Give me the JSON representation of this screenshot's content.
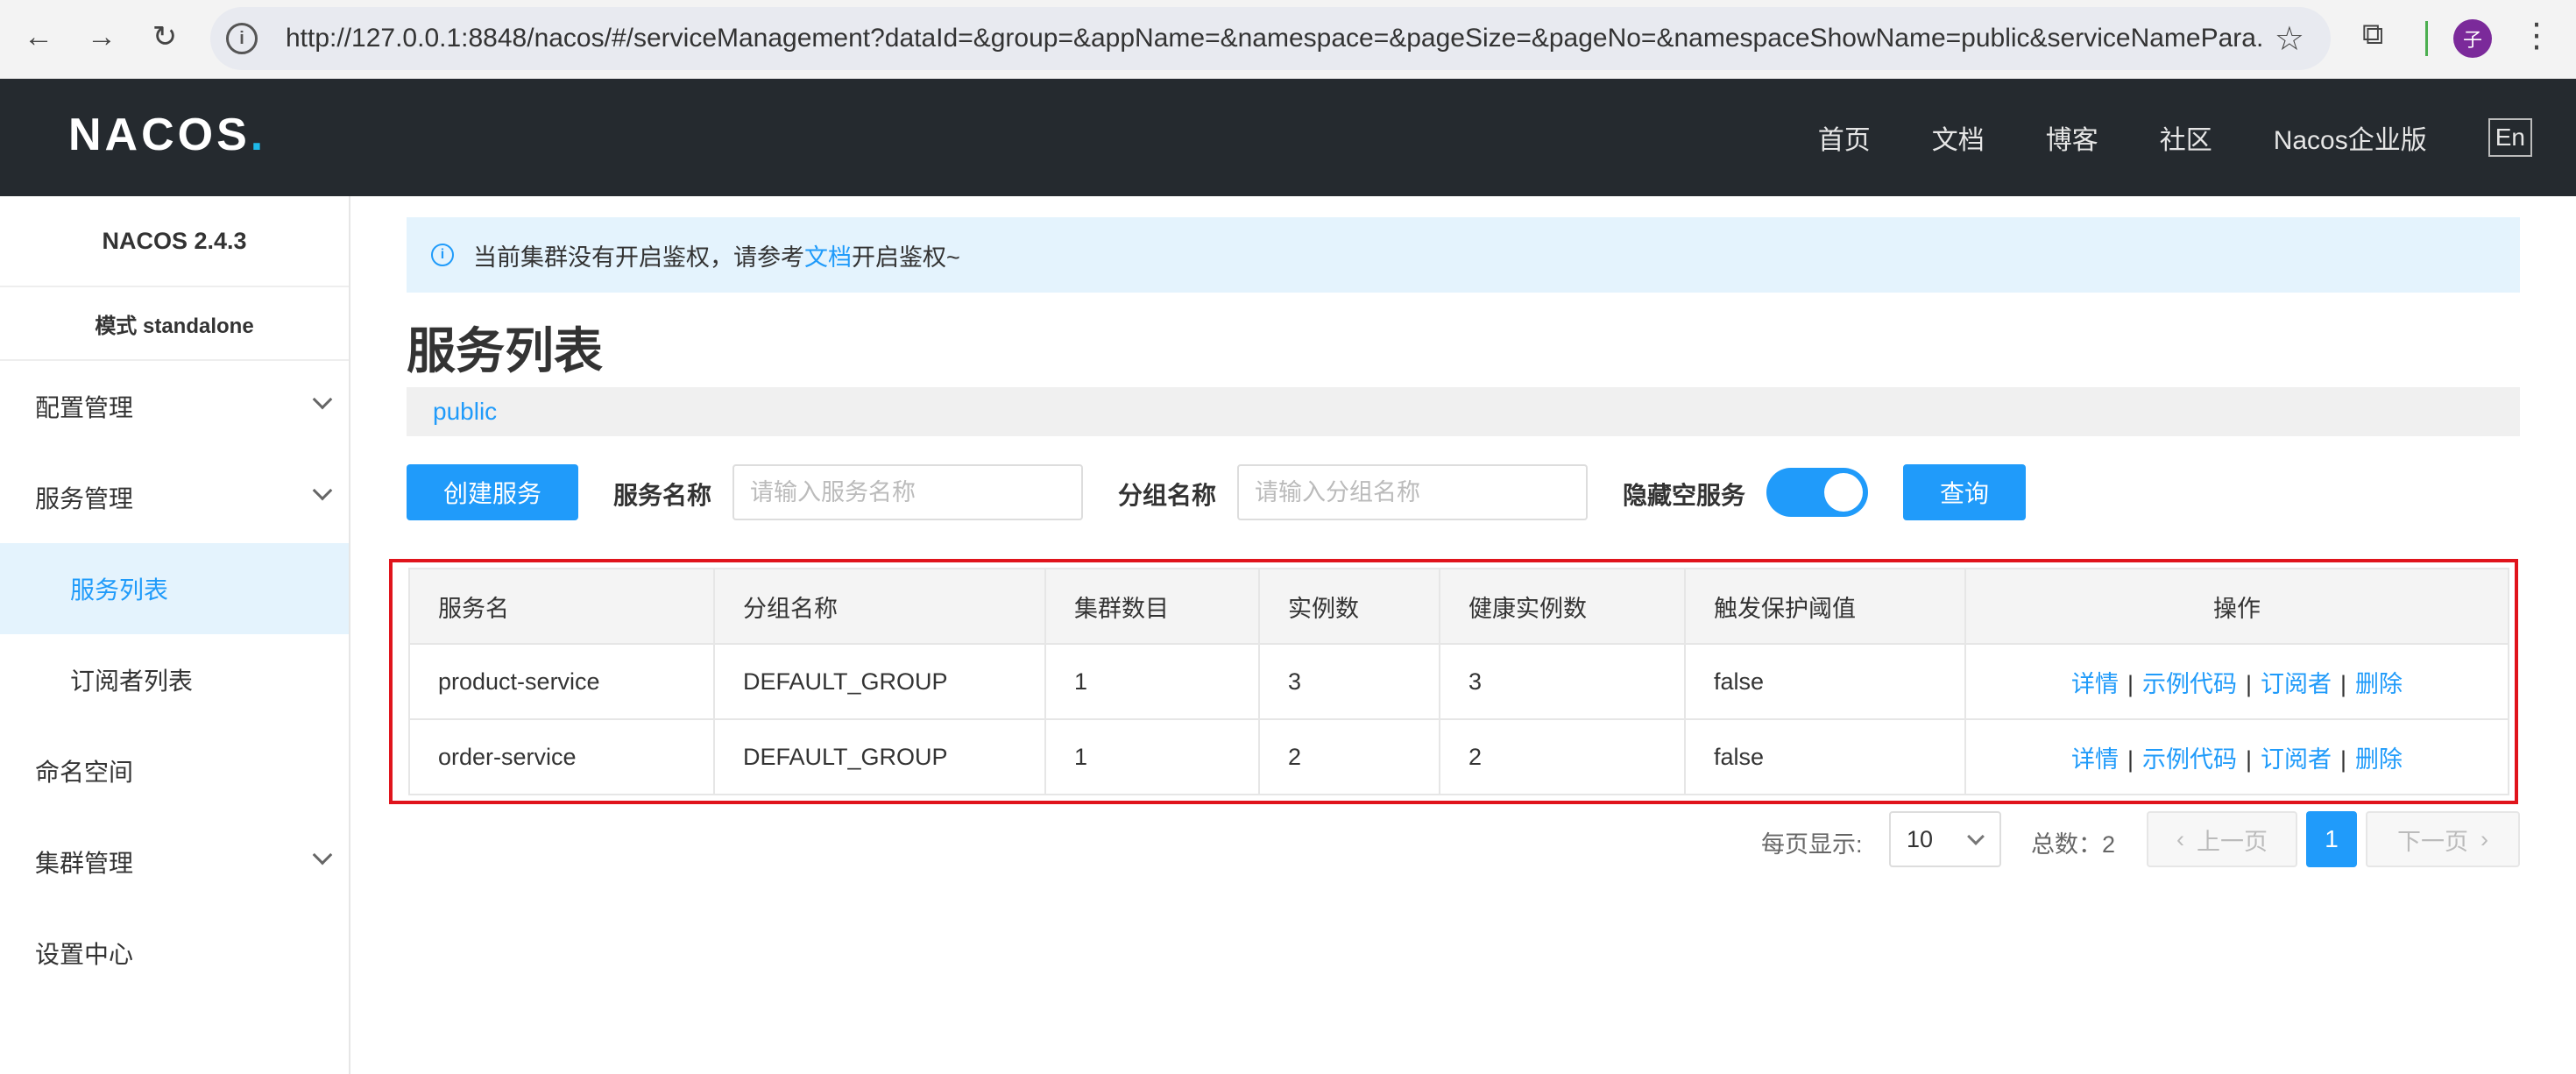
{
  "browser": {
    "url": "http://127.0.0.1:8848/nacos/#/serviceManagement?dataId=&group=&appName=&namespace=&pageSize=&pageNo=&namespaceShowName=public&serviceNamePara...",
    "profile_initial": "子"
  },
  "header": {
    "logo": "NACOS",
    "logo_dot": ".",
    "nav": [
      "首页",
      "文档",
      "博客",
      "社区",
      "Nacos企业版"
    ],
    "lang": "En"
  },
  "sidebar": {
    "version": "NACOS 2.4.3",
    "mode": "模式 standalone",
    "items": [
      {
        "label": "配置管理"
      },
      {
        "label": "服务管理"
      },
      {
        "label": "服务列表"
      },
      {
        "label": "订阅者列表"
      },
      {
        "label": "命名空间"
      },
      {
        "label": "集群管理"
      },
      {
        "label": "设置中心"
      }
    ]
  },
  "alert": {
    "text_before": "当前集群没有开启鉴权，请参考",
    "link": "文档",
    "text_after": "开启鉴权~"
  },
  "page": {
    "title": "服务列表",
    "namespace": "public"
  },
  "toolbar": {
    "create_label": "创建服务",
    "service_name_label": "服务名称",
    "service_name_placeholder": "请输入服务名称",
    "group_name_label": "分组名称",
    "group_name_placeholder": "请输入分组名称",
    "hide_empty_label": "隐藏空服务",
    "hide_empty_on": true,
    "query_label": "查询"
  },
  "table": {
    "headers": [
      "服务名",
      "分组名称",
      "集群数目",
      "实例数",
      "健康实例数",
      "触发保护阈值",
      "操作"
    ],
    "rows": [
      [
        "product-service",
        "DEFAULT_GROUP",
        "1",
        "3",
        "3",
        "false"
      ],
      [
        "order-service",
        "DEFAULT_GROUP",
        "1",
        "2",
        "2",
        "false"
      ]
    ],
    "ops": [
      "详情",
      "示例代码",
      "订阅者",
      "删除"
    ]
  },
  "pager": {
    "per_page_label": "每页显示:",
    "per_page_value": "10",
    "total_label": "总数：2",
    "prev": "上一页",
    "current": "1",
    "next": "下一页"
  },
  "colors": {
    "accent": "#209bfa",
    "header_bg": "#252a2f",
    "highlight_border": "#e0141c"
  }
}
